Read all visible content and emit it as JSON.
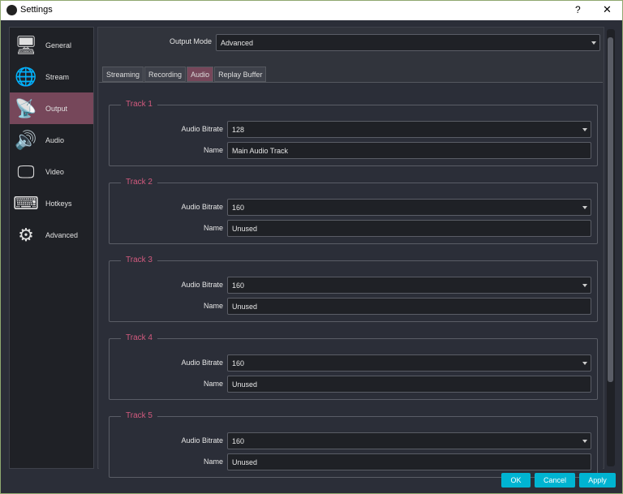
{
  "window": {
    "title": "Settings",
    "help": "?",
    "close": "✕"
  },
  "sidebar": {
    "items": [
      {
        "label": "General",
        "icon": "general-icon",
        "glyph": "🖥"
      },
      {
        "label": "Stream",
        "icon": "globe-icon",
        "glyph": "🌐"
      },
      {
        "label": "Output",
        "icon": "broadcast-icon",
        "glyph": "📡"
      },
      {
        "label": "Audio",
        "icon": "speaker-icon",
        "glyph": "🔊"
      },
      {
        "label": "Video",
        "icon": "monitor-icon",
        "glyph": "🖵"
      },
      {
        "label": "Hotkeys",
        "icon": "keyboard-icon",
        "glyph": "⌨"
      },
      {
        "label": "Advanced",
        "icon": "gears-icon",
        "glyph": "⚙"
      }
    ],
    "active": "Output"
  },
  "output_mode": {
    "label": "Output Mode",
    "value": "Advanced"
  },
  "tabs": [
    {
      "label": "Streaming"
    },
    {
      "label": "Recording"
    },
    {
      "label": "Audio",
      "active": true
    },
    {
      "label": "Replay Buffer"
    }
  ],
  "tracks": [
    {
      "title": "Track 1",
      "bitrate_label": "Audio Bitrate",
      "bitrate": "128",
      "name_label": "Name",
      "name": "Main Audio Track"
    },
    {
      "title": "Track 2",
      "bitrate_label": "Audio Bitrate",
      "bitrate": "160",
      "name_label": "Name",
      "name": "Unused"
    },
    {
      "title": "Track 3",
      "bitrate_label": "Audio Bitrate",
      "bitrate": "160",
      "name_label": "Name",
      "name": "Unused"
    },
    {
      "title": "Track 4",
      "bitrate_label": "Audio Bitrate",
      "bitrate": "160",
      "name_label": "Name",
      "name": "Unused"
    },
    {
      "title": "Track 5",
      "bitrate_label": "Audio Bitrate",
      "bitrate": "160",
      "name_label": "Name",
      "name": "Unused"
    }
  ],
  "buttons": {
    "ok": "OK",
    "cancel": "Cancel",
    "apply": "Apply"
  },
  "colors": {
    "accent": "#d25a7e",
    "button": "#00b4d2",
    "active": "#76475a"
  }
}
